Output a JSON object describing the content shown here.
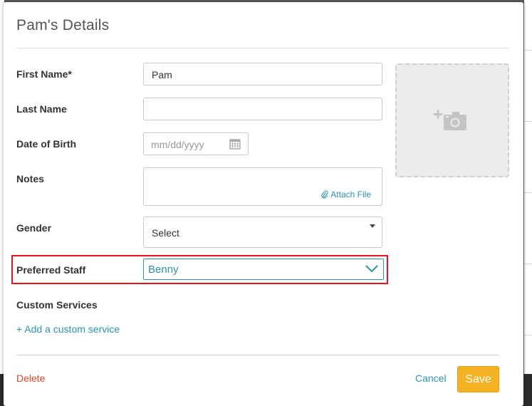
{
  "modal": {
    "title": "Pam's Details"
  },
  "form": {
    "first_name": {
      "label": "First Name*",
      "value": "Pam"
    },
    "last_name": {
      "label": "Last Name",
      "value": ""
    },
    "dob": {
      "label": "Date of Birth",
      "placeholder": "mm/dd/yyyy"
    },
    "notes": {
      "label": "Notes",
      "attach_label": "Attach File"
    },
    "gender": {
      "label": "Gender",
      "value": "Select"
    },
    "preferred_staff": {
      "label": "Preferred Staff",
      "value": "Benny"
    },
    "custom_services": {
      "label": "Custom Services",
      "add_link": "+ Add a custom service"
    }
  },
  "footer": {
    "delete_label": "Delete",
    "cancel_label": "Cancel",
    "save_label": "Save"
  },
  "colors": {
    "accent": "#2a93b0",
    "delete": "#d9472b",
    "save": "#f5b324",
    "highlight": "#e3141b"
  },
  "icons": [
    "calendar-icon",
    "paperclip-icon",
    "chevron-down-icon",
    "add-photo-icon"
  ]
}
